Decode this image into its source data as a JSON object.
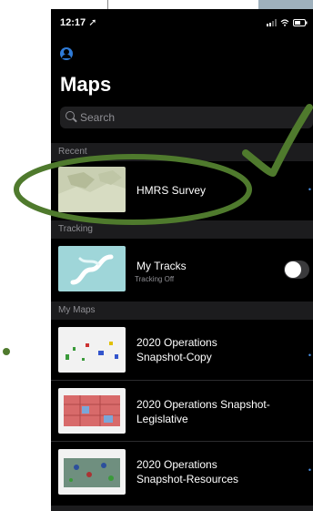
{
  "status_bar": {
    "time": "12:17 ➚"
  },
  "header": {
    "title": "Maps"
  },
  "search": {
    "placeholder": "Search"
  },
  "sections": {
    "recent": "Recent",
    "tracking": "Tracking",
    "my_maps": "My Maps"
  },
  "recent_items": [
    {
      "title": "HMRS Survey"
    }
  ],
  "tracking": {
    "title": "My Tracks",
    "status": "Tracking Off",
    "enabled": false
  },
  "my_maps": [
    {
      "title_line1": "2020 Operations",
      "title_line2": "Snapshot-Copy"
    },
    {
      "title_line1": "2020 Operations Snapshot-",
      "title_line2": "Legislative"
    },
    {
      "title_line1": "2020 Operations",
      "title_line2": "Snapshot-Resources"
    }
  ],
  "colors": {
    "annotation": "#4f7a2d",
    "accent": "#2f7bd8"
  },
  "icons": {
    "profile": "profile-icon",
    "search": "search-icon",
    "more": "more-icon"
  }
}
